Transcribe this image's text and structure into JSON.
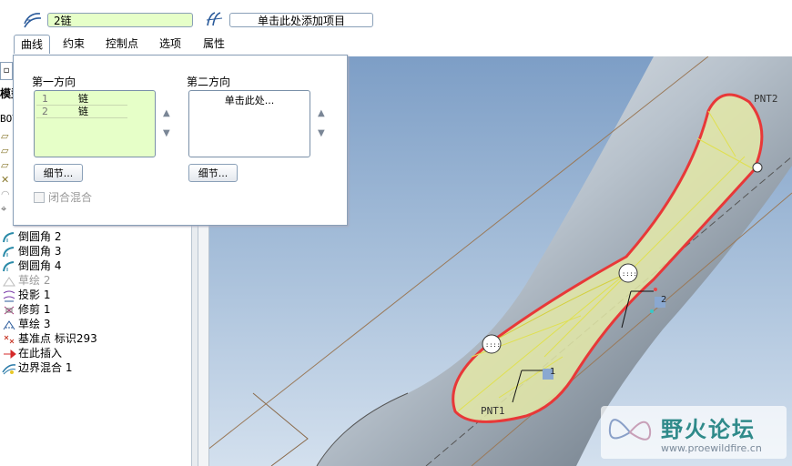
{
  "dashboard": {
    "chain_field_value": "2链",
    "add_item_placeholder": "单击此处添加项目",
    "tabs": [
      {
        "label": "曲线"
      },
      {
        "label": "约束"
      },
      {
        "label": "控制点"
      },
      {
        "label": "选项"
      },
      {
        "label": "属性"
      }
    ]
  },
  "panel": {
    "first_direction_label": "第一方向",
    "second_direction_label": "第二方向",
    "first_direction_rows": [
      {
        "num": "1",
        "text": "链"
      },
      {
        "num": "2",
        "text": "链"
      }
    ],
    "second_direction_hint": "单击此处...",
    "details_button_1": "细节...",
    "details_button_2": "细节...",
    "closed_blend_label": "闭合混合",
    "closed_blend_checked": false
  },
  "tree": {
    "header_fragment": "模型",
    "top_fragment": "BOT",
    "items": [
      {
        "label": "倒圆角 2",
        "icon": "round-icon",
        "dim": false
      },
      {
        "label": "倒圆角 3",
        "icon": "round-icon",
        "dim": false
      },
      {
        "label": "倒圆角 4",
        "icon": "round-icon",
        "dim": false
      },
      {
        "label": "草绘 2",
        "icon": "sketch-icon",
        "dim": true
      },
      {
        "label": "投影 1",
        "icon": "projection-icon",
        "dim": false
      },
      {
        "label": "修剪 1",
        "icon": "trim-icon",
        "dim": false
      },
      {
        "label": "草绘 3",
        "icon": "sketch-icon",
        "dim": false
      },
      {
        "label": "基准点 标识293",
        "icon": "datum-point-icon",
        "dim": false
      },
      {
        "label": "在此插入",
        "icon": "insert-here-arrow-icon",
        "dim": false
      },
      {
        "label": "边界混合 1",
        "icon": "boundary-blend-icon",
        "dim": false
      }
    ]
  },
  "viewport": {
    "point_label_1": "PNT2",
    "point_label_2": "PNT1",
    "handle_label_1": "1",
    "handle_label_2": "2"
  },
  "watermark": {
    "title": "野火论坛",
    "url": "www.proewildfire.cn"
  },
  "colors": {
    "surface_fill": "#e4e9a8",
    "boundary": "#e83838",
    "list_bg": "#e6ffc8"
  }
}
